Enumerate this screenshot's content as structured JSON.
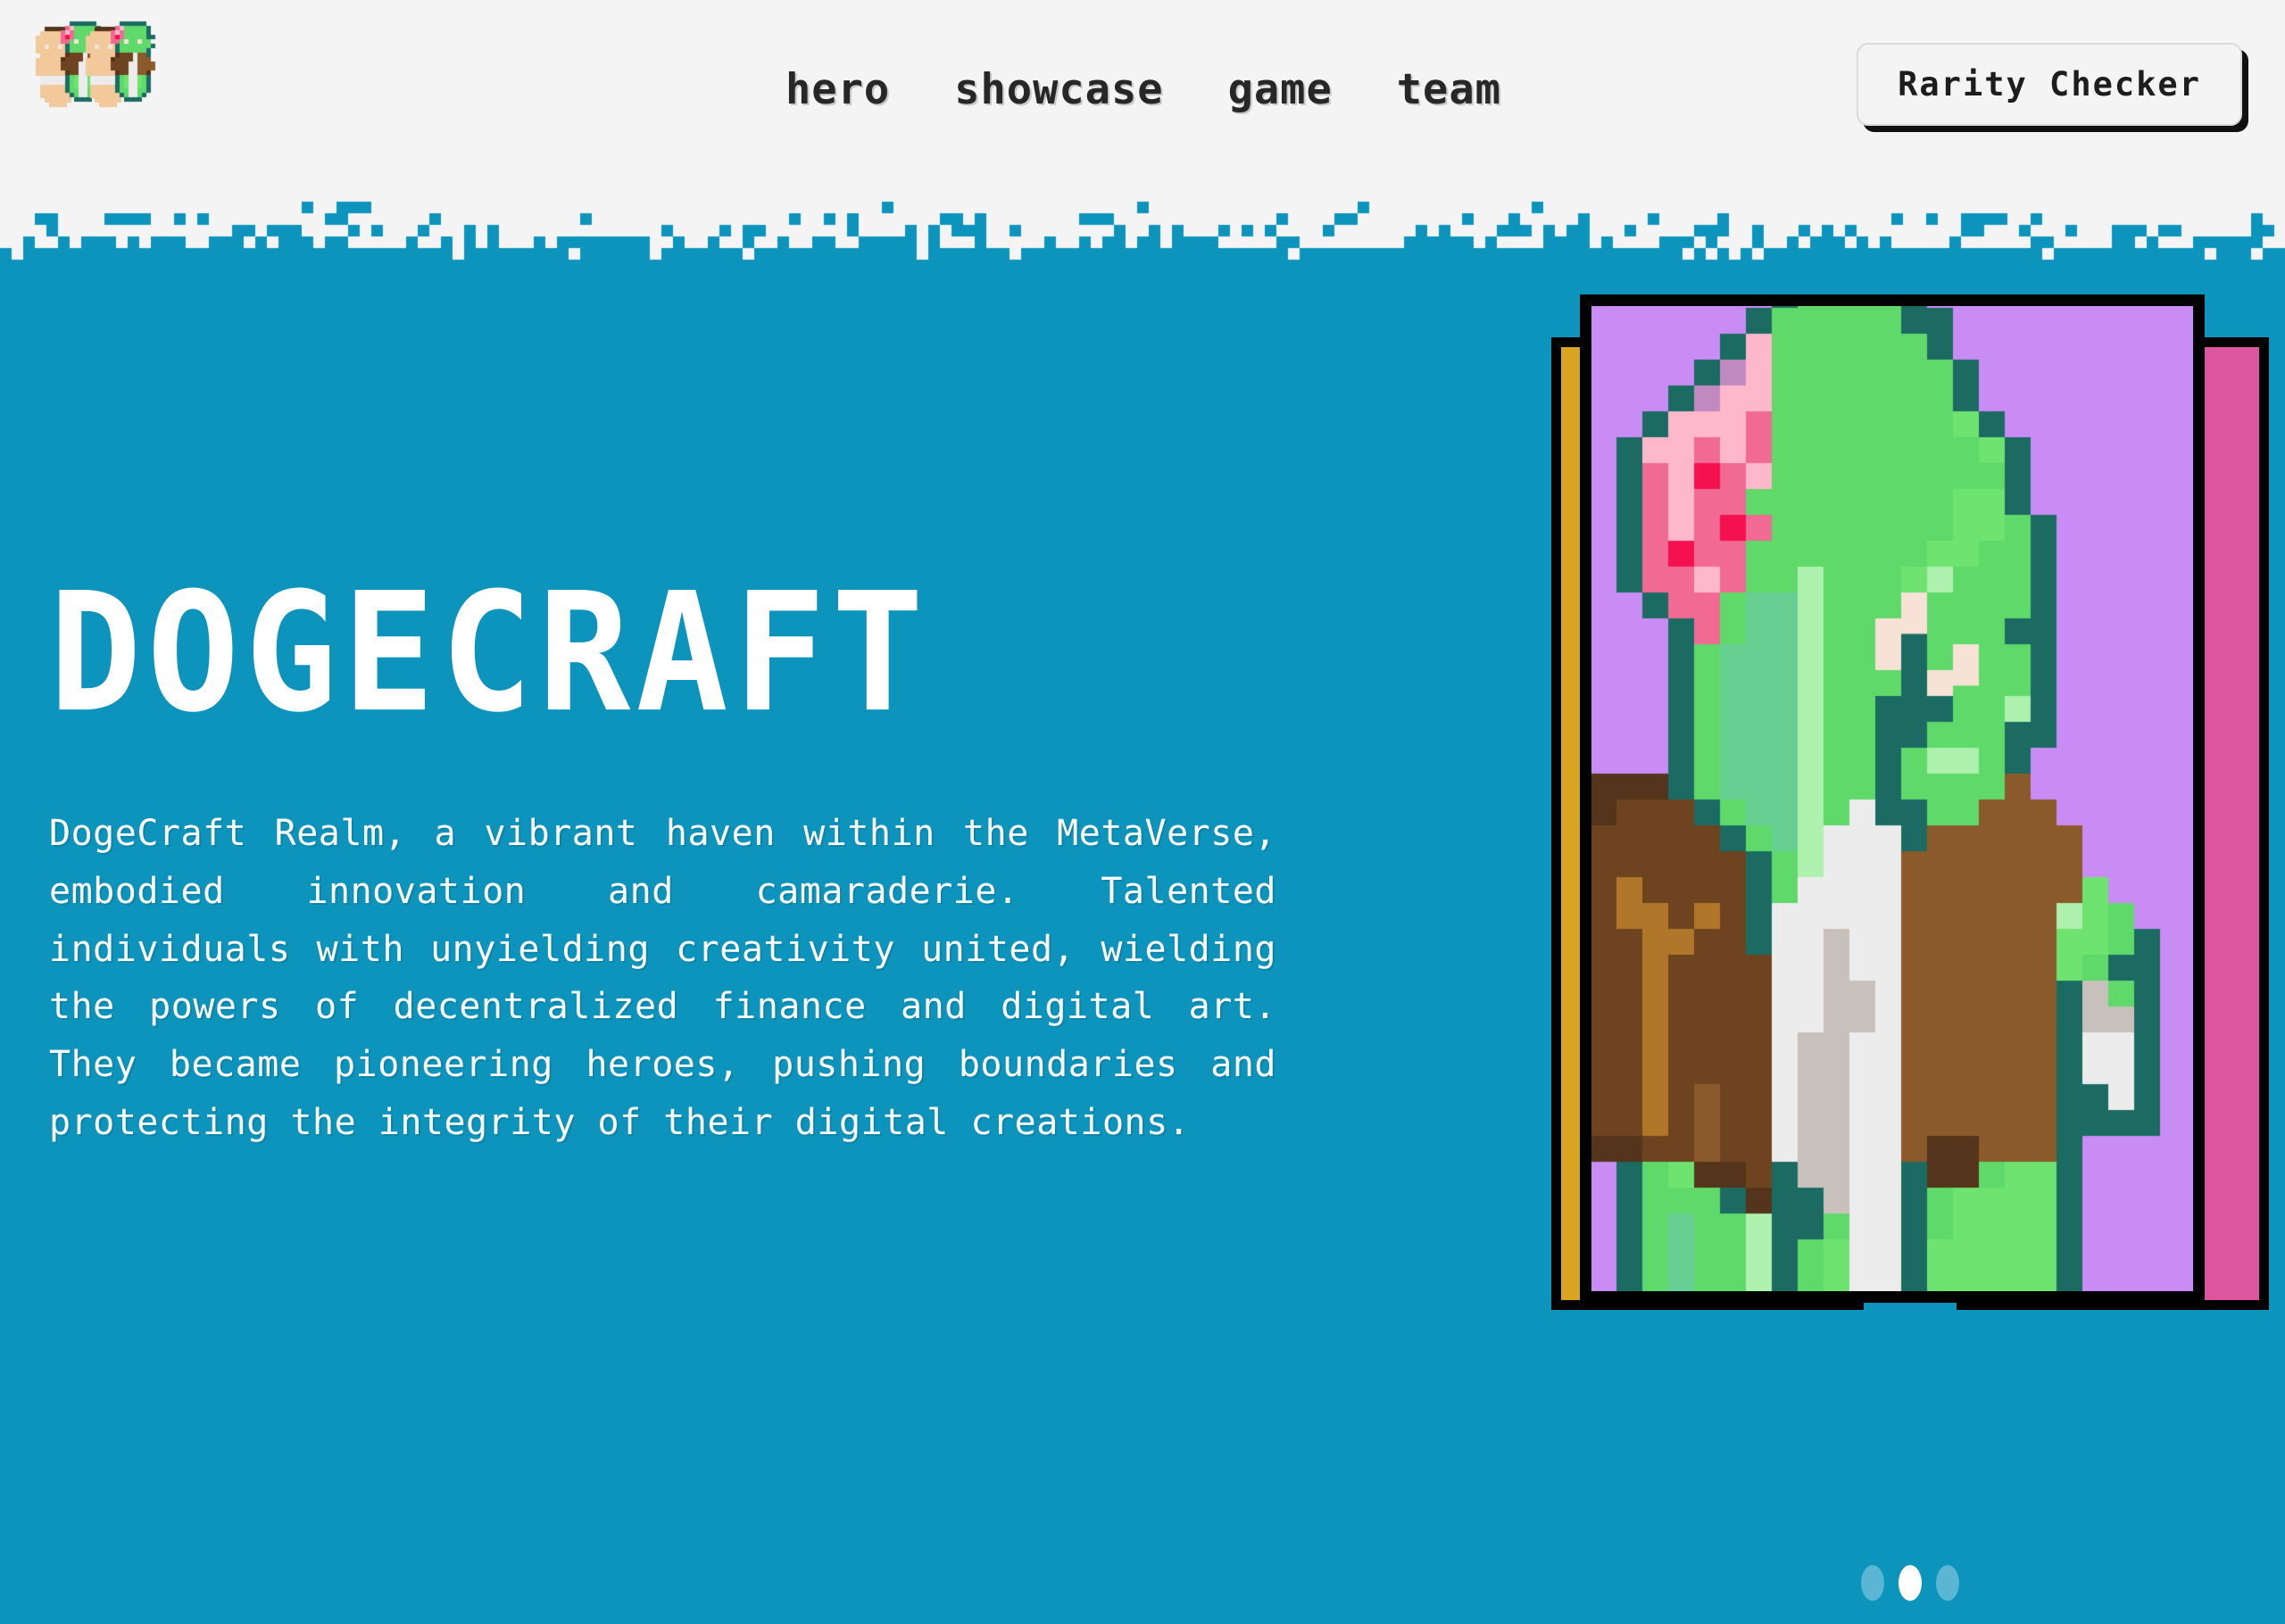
{
  "theme": {
    "brand_blue": "#0c94bd",
    "header_bg": "#f4f4f4",
    "ink": "#272727",
    "card_purple": "#c98cf5",
    "card_yellow": "#d9a520",
    "card_pink": "#dd559f",
    "outline_black": "#000000",
    "text_white": "#ffffff"
  },
  "header": {
    "logo_name": "dogecraft-pixel-logo",
    "nav": [
      {
        "label": "hero",
        "name": "nav-item-hero"
      },
      {
        "label": "showcase",
        "name": "nav-item-showcase"
      },
      {
        "label": "game",
        "name": "nav-item-game"
      },
      {
        "label": "team",
        "name": "nav-item-team"
      }
    ],
    "cta": {
      "label": "Rarity Checker"
    }
  },
  "hero": {
    "title": "DOGECRAFT",
    "description": "DogeCraft Realm, a vibrant haven within the MetaVerse, embodied innovation and camaraderie. Talented individuals with unyielding creativity united, wielding the powers of decentralized finance and digital art. They became pioneering heroes, pushing boundaries and protecting the integrity of their digital creations."
  },
  "carousel": {
    "cards": [
      {
        "name": "card-behind-left",
        "color": "#d9a520"
      },
      {
        "name": "card-active",
        "color": "#c98cf5"
      },
      {
        "name": "card-behind-right",
        "color": "#dd559f"
      }
    ],
    "active_index": 1,
    "dots": [
      {
        "active": false
      },
      {
        "active": true
      },
      {
        "active": false
      }
    ],
    "artwork_name": "pixel-character-green-flower"
  }
}
